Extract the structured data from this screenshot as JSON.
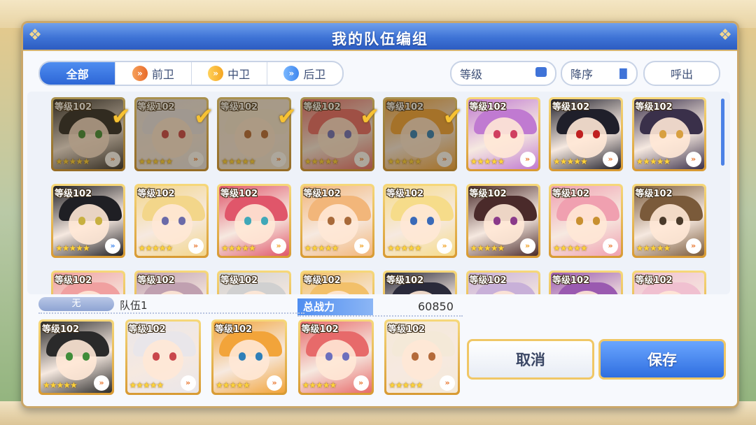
{
  "dialog": {
    "title": "我的队伍编组"
  },
  "filters": {
    "tabs": [
      {
        "label": "全部",
        "active": true
      },
      {
        "label": "前卫",
        "icon": "chevron-orange-icon"
      },
      {
        "label": "中卫",
        "icon": "chevron-yellow-icon"
      },
      {
        "label": "后卫",
        "icon": "chevron-blue-icon"
      }
    ],
    "sort_level": "等级",
    "sort_order": "降序",
    "call_out": "呼出"
  },
  "roster": [
    {
      "level": "等级102",
      "selected": true,
      "hair": "#2a2a2a",
      "eye": "#3f8d3a",
      "role": "front"
    },
    {
      "level": "等级102",
      "selected": true,
      "hair": "#e9e6ea",
      "eye": "#c9464b",
      "role": "front"
    },
    {
      "level": "等级102",
      "selected": true,
      "hair": "#f4e9d8",
      "eye": "#b46a3a",
      "role": "front"
    },
    {
      "level": "等级102",
      "selected": true,
      "hair": "#e76a6a",
      "eye": "#6c6fbd",
      "role": "front"
    },
    {
      "level": "等级102",
      "selected": true,
      "hair": "#f2a43a",
      "eye": "#2e7fb8",
      "role": "front"
    },
    {
      "level": "等级102",
      "selected": false,
      "hair": "#c07ad1",
      "eye": "#d04060",
      "role": "front"
    },
    {
      "level": "等级102",
      "selected": false,
      "hair": "#1f1f2a",
      "eye": "#c02020",
      "role": "front"
    },
    {
      "level": "等级102",
      "selected": false,
      "hair": "#3a304a",
      "eye": "#d8a040",
      "role": "front"
    },
    {
      "level": "等级102",
      "selected": false,
      "hair": "#1f1f24",
      "eye": "#c8b040",
      "role": "back"
    },
    {
      "level": "等级102",
      "selected": false,
      "hair": "#f3d68a",
      "eye": "#6a6aa8",
      "role": "front"
    },
    {
      "level": "等级102",
      "selected": false,
      "hair": "#e0566a",
      "eye": "#40a8b8",
      "role": "mid"
    },
    {
      "level": "等级102",
      "selected": false,
      "hair": "#f2b67a",
      "eye": "#a86a3a",
      "role": "mid"
    },
    {
      "level": "等级102",
      "selected": false,
      "hair": "#f6dc8a",
      "eye": "#3a6ab8",
      "role": "mid"
    },
    {
      "level": "等级102",
      "selected": false,
      "hair": "#4a2a2a",
      "eye": "#8a3a8a",
      "role": "mid"
    },
    {
      "level": "等级102",
      "selected": false,
      "hair": "#f0a0b0",
      "eye": "#c89030",
      "role": "front"
    },
    {
      "level": "等级102",
      "selected": false,
      "hair": "#7a5a3a",
      "eye": "#4a3a2a",
      "role": "front"
    },
    {
      "level": "等级102",
      "selected": false,
      "hair": "#f0a0a0",
      "eye": "#6a6a6a",
      "role": "front"
    },
    {
      "level": "等级102",
      "selected": false,
      "hair": "#c0a0b0",
      "eye": "#6a6a6a",
      "role": "front"
    },
    {
      "level": "等级102",
      "selected": false,
      "hair": "#d0d0d0",
      "eye": "#6a6a6a",
      "role": "front"
    },
    {
      "level": "等级102",
      "selected": false,
      "hair": "#f2c06a",
      "eye": "#6a6a6a",
      "role": "front"
    },
    {
      "level": "等级102",
      "selected": false,
      "hair": "#2a2a3a",
      "eye": "#6a6a6a",
      "role": "front"
    },
    {
      "level": "等级102",
      "selected": false,
      "hair": "#c8b0d8",
      "eye": "#6a6a6a",
      "role": "front"
    },
    {
      "level": "等级102",
      "selected": false,
      "hair": "#9a5ab0",
      "eye": "#6a6a6a",
      "role": "front"
    },
    {
      "level": "等级102",
      "selected": false,
      "hair": "#f0c0d0",
      "eye": "#6a6a6a",
      "role": "front"
    }
  ],
  "team": {
    "tag": "无",
    "name": "队伍1",
    "power_label": "总战力",
    "power_value": "60850",
    "members": [
      {
        "level": "等级102",
        "hair": "#2a2a2a",
        "eye": "#3f8d3a",
        "role": "front"
      },
      {
        "level": "等级102",
        "hair": "#e9e6ea",
        "eye": "#c9464b",
        "role": "front"
      },
      {
        "level": "等级102",
        "hair": "#f2a43a",
        "eye": "#2e7fb8",
        "role": "front"
      },
      {
        "level": "等级102",
        "hair": "#e76a6a",
        "eye": "#6c6fbd",
        "role": "front"
      },
      {
        "level": "等级102",
        "hair": "#f4e9d8",
        "eye": "#b46a3a",
        "role": "front"
      }
    ]
  },
  "actions": {
    "cancel": "取消",
    "save": "保存"
  },
  "stars": "★★★★★"
}
